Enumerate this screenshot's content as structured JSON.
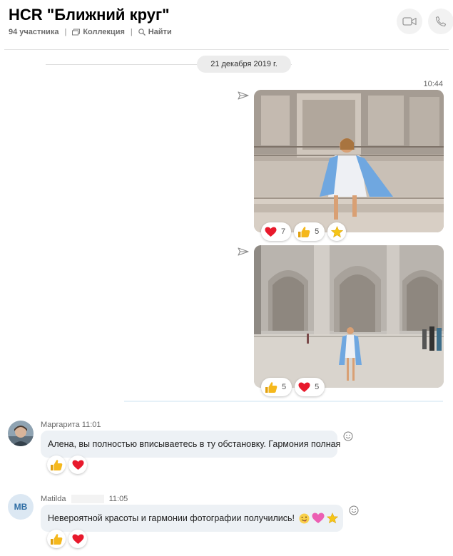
{
  "header": {
    "title": "HCR \"Ближний круг\"",
    "participants": "94 участника",
    "collection": "Коллекция",
    "find": "Найти",
    "video_icon": "video-camera-icon",
    "call_icon": "phone-icon"
  },
  "date_separator": "21 декабря 2019 г.",
  "outgoing": {
    "time": "10:44",
    "photo1": {
      "reactions": [
        {
          "icon": "heart",
          "count": "7"
        },
        {
          "icon": "thumbs-up",
          "count": "5"
        },
        {
          "icon": "star",
          "count": ""
        }
      ]
    },
    "photo2": {
      "reactions": [
        {
          "icon": "thumbs-up",
          "count": "5"
        },
        {
          "icon": "heart",
          "count": "5"
        }
      ]
    }
  },
  "messages": [
    {
      "sender": "Маргарита",
      "time": "11:01",
      "text": "Алена, вы полностью вписываетесь в ту обстановку. Гармония полная",
      "reactions": [
        "thumbs-up",
        "heart"
      ]
    },
    {
      "sender": "Matilda",
      "avatar_initials": "MB",
      "time": "11:05",
      "text": "Невероятной красоты и гармонии фотографии получились!",
      "reactions": [
        "thumbs-up",
        "heart"
      ]
    }
  ],
  "colors": {
    "heart": "#e8192c",
    "thumb": "#f5b81c",
    "star": "#f5c518",
    "avatar_mb_bg": "#dce8f3",
    "avatar_mb_text": "#2e6da4"
  }
}
